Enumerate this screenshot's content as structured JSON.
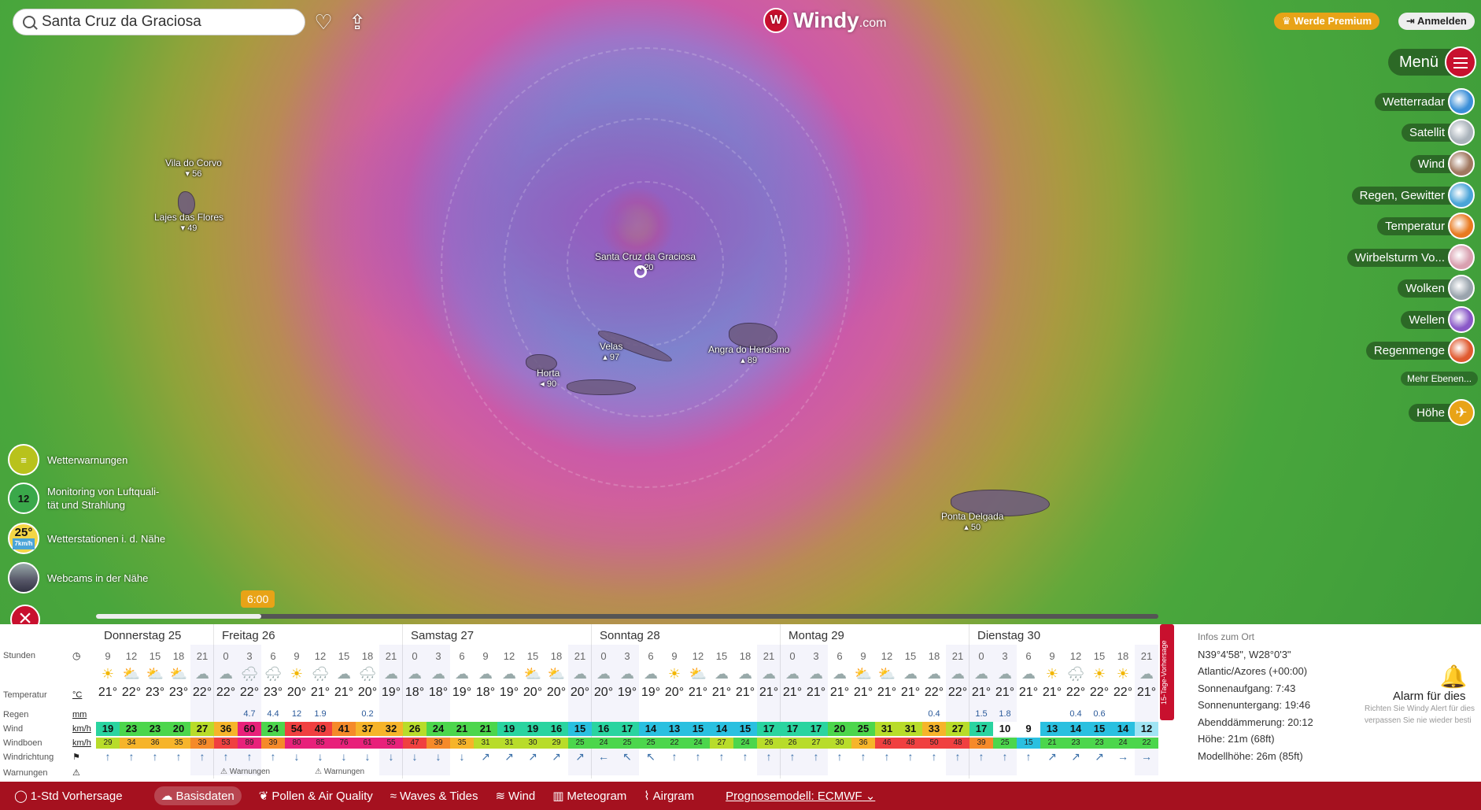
{
  "search": {
    "value": "Santa Cruz da Graciosa"
  },
  "header": {
    "logo_main": "Windy",
    "logo_sub": ".com",
    "premium": "Werde Premium",
    "login": "Anmelden",
    "menu": "Menü"
  },
  "layers": [
    {
      "label": "Wetterradar",
      "color": "#3b8fd8"
    },
    {
      "label": "Satellit",
      "color": "#aab3bb"
    },
    {
      "label": "Wind",
      "color": "#a07860"
    },
    {
      "label": "Regen, Gewitter",
      "color": "#4aa4d8"
    },
    {
      "label": "Temperatur",
      "color": "#e87a20"
    },
    {
      "label": "Wirbelsturm Vo...",
      "color": "#d9a0b0"
    },
    {
      "label": "Wolken",
      "color": "#9aa4ad"
    },
    {
      "label": "Wellen",
      "color": "#8a58c8"
    },
    {
      "label": "Regenmenge",
      "color": "#e05a30"
    }
  ],
  "more_layers": "Mehr Ebenen...",
  "altitude_label": "Höhe",
  "places": [
    {
      "name": "Vila do Corvo",
      "val": "56"
    },
    {
      "name": "Lajes das Flores",
      "val": "49"
    },
    {
      "name": "Santa Cruz da Graciosa",
      "val": "20"
    },
    {
      "name": "Velas",
      "val": "97"
    },
    {
      "name": "Horta",
      "val": "90"
    },
    {
      "name": "Angra do Heroismo",
      "val": "89"
    },
    {
      "name": "Ponta Delgada",
      "val": "50"
    }
  ],
  "left_items": [
    {
      "label": "Wetterwarnungen",
      "badge": ""
    },
    {
      "label": "Monitoring von Luftqualität und Strahlung",
      "line1": "Monitoring von Luftquali-",
      "line2": "tät und Strahlung",
      "badge": "12"
    },
    {
      "label": "Wetterstationen i. d. Nähe",
      "badge": "25°",
      "badge_sub": "7km/h"
    },
    {
      "label": "Webcams in der Nähe",
      "badge": ""
    }
  ],
  "time_bubble": "6:00",
  "forecast": {
    "days": [
      "Donnerstag 25",
      "Freitag 26",
      "Samstag 27",
      "Sonntag 28",
      "Montag 29",
      "Dienstag 30"
    ],
    "row_labels": {
      "hours": "Stunden",
      "temp": "Temperatur",
      "temp_unit": "°C",
      "rain": "Regen",
      "rain_unit": "mm",
      "wind": "Wind",
      "wind_unit": "km/h",
      "gust": "Windboen",
      "gust_unit": "km/h",
      "dir": "Windrichtung",
      "warn": "Warnungen"
    },
    "hours": [
      "9",
      "12",
      "15",
      "18",
      "21",
      "0",
      "3",
      "6",
      "9",
      "12",
      "15",
      "18",
      "21",
      "0",
      "3",
      "6",
      "9",
      "12",
      "15",
      "18",
      "21",
      "0",
      "3",
      "6",
      "9",
      "12",
      "15",
      "18",
      "21",
      "0",
      "3",
      "6",
      "9",
      "12",
      "15",
      "18",
      "21",
      "0",
      "3",
      "6",
      "9",
      "12",
      "15",
      "18",
      "21"
    ],
    "icons": [
      "☀",
      "⛅",
      "⛅",
      "⛅",
      "☁",
      "☁",
      "🌧",
      "🌧",
      "☀",
      "🌧",
      "☁",
      "🌧",
      "☁",
      "☁",
      "☁",
      "☁",
      "☁",
      "☁",
      "⛅",
      "⛅",
      "☁",
      "☁",
      "☁",
      "☁",
      "☀",
      "⛅",
      "☁",
      "☁",
      "☁",
      "☁",
      "☁",
      "☁",
      "⛅",
      "⛅",
      "☁",
      "☁",
      "☁",
      "☁",
      "☁",
      "☁",
      "☀",
      "🌧",
      "☀",
      "☀",
      "☁"
    ],
    "temps": [
      "21°",
      "22°",
      "23°",
      "23°",
      "22°",
      "22°",
      "22°",
      "23°",
      "20°",
      "21°",
      "21°",
      "20°",
      "19°",
      "18°",
      "18°",
      "19°",
      "18°",
      "19°",
      "20°",
      "20°",
      "20°",
      "20°",
      "19°",
      "19°",
      "20°",
      "21°",
      "21°",
      "21°",
      "21°",
      "21°",
      "21°",
      "21°",
      "21°",
      "21°",
      "21°",
      "22°",
      "22°",
      "21°",
      "21°",
      "21°",
      "21°",
      "22°",
      "22°",
      "22°",
      "21°"
    ],
    "rain": [
      "",
      "",
      "",
      "",
      "",
      "",
      "4.7",
      "4.4",
      "12",
      "1.9",
      "",
      "0.2",
      "",
      "",
      "",
      "",
      "",
      "",
      "",
      "",
      "",
      "",
      "",
      "",
      "",
      "",
      "",
      "",
      "",
      "",
      "",
      "",
      "",
      "",
      "",
      "0.4",
      "",
      "1.5",
      "1.8",
      "",
      "",
      "0.4",
      "0.6",
      "",
      ""
    ],
    "wind": [
      "19",
      "23",
      "23",
      "20",
      "27",
      "36",
      "60",
      "24",
      "54",
      "49",
      "41",
      "37",
      "32",
      "26",
      "24",
      "21",
      "21",
      "19",
      "19",
      "16",
      "15",
      "16",
      "17",
      "14",
      "13",
      "15",
      "14",
      "15",
      "17",
      "17",
      "17",
      "20",
      "25",
      "31",
      "31",
      "33",
      "27",
      "17",
      "10",
      "9",
      "13",
      "14",
      "15",
      "14",
      "12"
    ],
    "gust": [
      "29",
      "34",
      "36",
      "35",
      "39",
      "53",
      "89",
      "39",
      "80",
      "85",
      "76",
      "61",
      "55",
      "47",
      "39",
      "35",
      "31",
      "31",
      "30",
      "29",
      "25",
      "24",
      "25",
      "25",
      "22",
      "24",
      "27",
      "24",
      "26",
      "26",
      "27",
      "30",
      "36",
      "46",
      "48",
      "50",
      "48",
      "39",
      "25",
      "15",
      "21",
      "23",
      "23",
      "24",
      "22"
    ],
    "dirs": [
      "↑",
      "↑",
      "↑",
      "↑",
      "↑",
      "↑",
      "↑",
      "↑",
      "↓",
      "↓",
      "↓",
      "↓",
      "↓",
      "↓",
      "↓",
      "↓",
      "↗",
      "↗",
      "↗",
      "↗",
      "↗",
      "←",
      "↖",
      "↖",
      "↑",
      "↑",
      "↑",
      "↑",
      "↑",
      "↑",
      "↑",
      "↑",
      "↑",
      "↑",
      "↑",
      "↑",
      "↑",
      "↑",
      "↑",
      "↑",
      "↗",
      "↗",
      "↗",
      "→",
      "→"
    ],
    "warnings": [
      "Warnungen",
      "Warnungen"
    ]
  },
  "info": {
    "title": "Infos zum Ort",
    "coords": "N39°4'58\", W28°0'3\"",
    "tz": "Atlantic/Azores (+00:00)",
    "sunrise": "Sonnenaufgang: 7:43",
    "sunset": "Sonnenuntergang: 19:46",
    "dusk": "Abenddämmerung: 20:12",
    "height": "Höhe: 21m (68ft)",
    "model_height": "Modellhöhe: 26m (85ft)",
    "side_tab": "15-Tage-Vorhersage"
  },
  "alarm": {
    "title": "Alarm für dies",
    "desc1": "Richten Sie Windy Alert für dies",
    "desc2": "verpassen Sie nie wieder besti"
  },
  "bottom": {
    "hourly": "1-Std Vorhersage",
    "tabs": [
      "Basisdaten",
      "Pollen & Air Quality",
      "Waves & Tides",
      "Wind",
      "Meteogram",
      "Airgram"
    ],
    "model": "Prognosemodell: ECMWF"
  }
}
